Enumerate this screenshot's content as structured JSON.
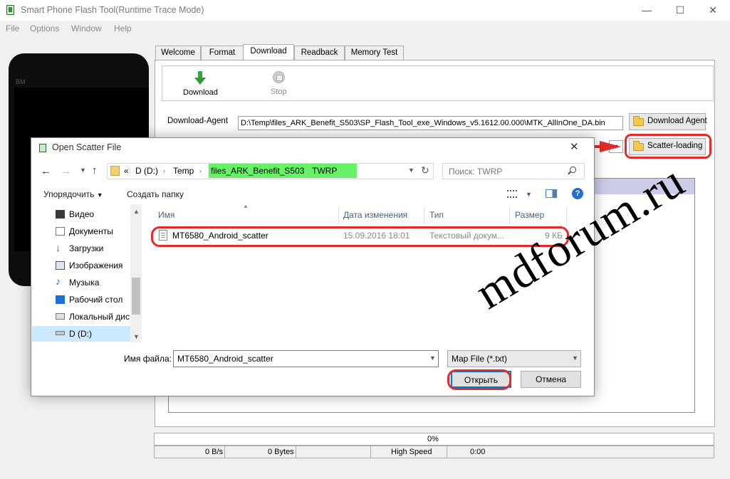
{
  "window": {
    "title": "Smart Phone Flash Tool(Runtime Trace Mode)",
    "controls": [
      "—",
      "☐",
      "✕"
    ]
  },
  "menu": [
    "File",
    "Options",
    "Window",
    "Help"
  ],
  "phone": {
    "brand": "BM"
  },
  "tabs": [
    {
      "label": "Welcome",
      "active": false
    },
    {
      "label": "Format",
      "active": false
    },
    {
      "label": "Download",
      "active": true
    },
    {
      "label": "Readback",
      "active": false
    },
    {
      "label": "Memory Test",
      "active": false
    }
  ],
  "toolbar": {
    "download_label": "Download",
    "stop_label": "Stop"
  },
  "download_agent": {
    "label": "Download-Agent",
    "value": "D:\\Temp\\files_ARK_Benefit_S503\\SP_Flash_Tool_exe_Windows_v5.1612.00.000\\MTK_AllInOne_DA.bin",
    "button": "Download Agent"
  },
  "scatter": {
    "button": "Scatter-loading"
  },
  "status": {
    "progress": "0%",
    "progress_value": 0,
    "speed": "0 B/s",
    "bytes": "0 Bytes",
    "mode": "High Speed",
    "time": "0:00"
  },
  "dialog": {
    "title": "Open Scatter File",
    "breadcrumb": [
      "D (D:)",
      "Temp",
      "files_ARK_Benefit_S503",
      "TWRP"
    ],
    "breadcrumb_prefix": "«",
    "search_placeholder": "Поиск: TWRP",
    "toolbar": {
      "organize": "Упорядочить",
      "new_folder": "Создать папку"
    },
    "nav_items": [
      {
        "label": "Видео",
        "icon": "video-icon"
      },
      {
        "label": "Документы",
        "icon": "documents-icon"
      },
      {
        "label": "Загрузки",
        "icon": "downloads-icon"
      },
      {
        "label": "Изображения",
        "icon": "images-icon"
      },
      {
        "label": "Музыка",
        "icon": "music-icon"
      },
      {
        "label": "Рабочий стол",
        "icon": "desktop-icon"
      },
      {
        "label": "Локальный дис",
        "icon": "local-disk-icon"
      },
      {
        "label": "D (D:)",
        "icon": "drive-icon",
        "selected": true
      }
    ],
    "columns": [
      "Имя",
      "Дата изменения",
      "Тип",
      "Размер"
    ],
    "files": [
      {
        "name": "MT6580_Android_scatter",
        "date": "15.09.2016 18:01",
        "type": "Текстовый докум...",
        "size": "9 КБ"
      }
    ],
    "filename_label": "Имя файла:",
    "filename_value": "MT6580_Android_scatter",
    "filetype_value": "Map File (*.txt)",
    "open_button": "Открыть",
    "cancel_button": "Отмена"
  },
  "watermark": "mdforum.ru",
  "colors": {
    "highlight_red": "#e42a2a",
    "breadcrumb_highlight": "#56ef56",
    "nav_selected": "#cce8ff",
    "accent_blue": "#0078d7"
  }
}
